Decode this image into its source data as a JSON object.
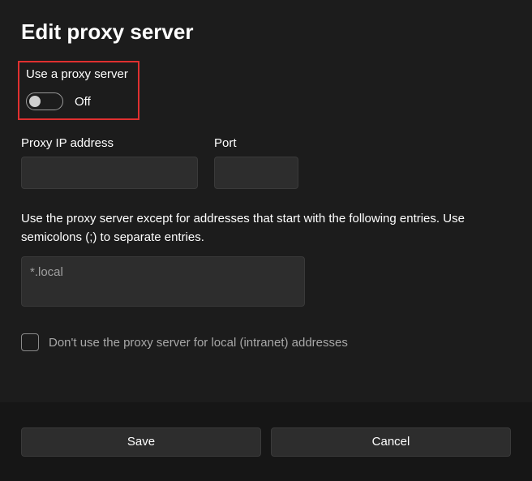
{
  "title": "Edit proxy server",
  "toggle": {
    "label": "Use a proxy server",
    "state": "Off",
    "on": false
  },
  "fields": {
    "ip_label": "Proxy IP address",
    "ip_value": "",
    "port_label": "Port",
    "port_value": ""
  },
  "exceptions": {
    "helper": "Use the proxy server except for addresses that start with the following entries. Use semicolons (;) to separate entries.",
    "value": "*.local"
  },
  "checkbox": {
    "label": "Don't use the proxy server for local (intranet) addresses",
    "checked": false
  },
  "buttons": {
    "save": "Save",
    "cancel": "Cancel"
  }
}
